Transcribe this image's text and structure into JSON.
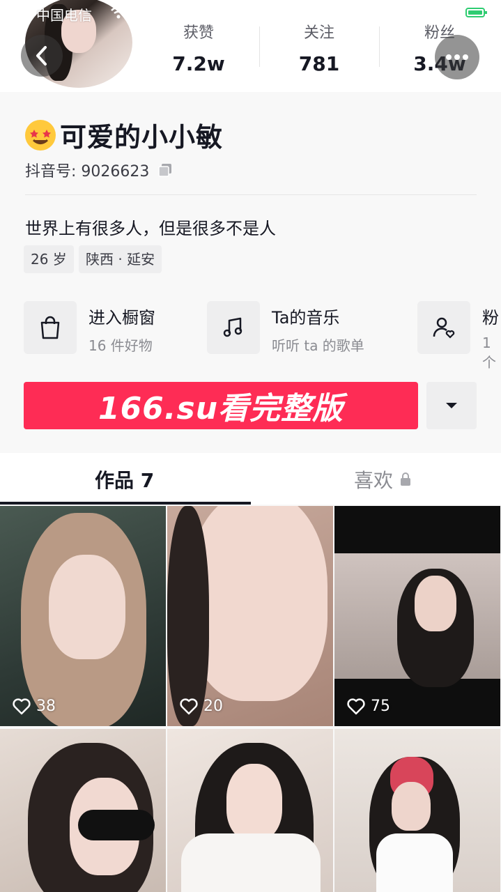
{
  "status_bar": {
    "carrier": "中国电信"
  },
  "stats": [
    {
      "label": "获赞",
      "value": "7.2w"
    },
    {
      "label": "关注",
      "value": "781"
    },
    {
      "label": "粉丝",
      "value": "3.4w"
    }
  ],
  "profile": {
    "name": "可爱的小小敏",
    "id_label": "抖音号: 9026623",
    "bio": "世界上有很多人，但是很多不是人",
    "tags": [
      "26 岁",
      "陕西 · 延安"
    ]
  },
  "features": [
    {
      "title": "进入橱窗",
      "subtitle": "16 件好物",
      "icon": "shopping-bag-icon"
    },
    {
      "title": "Ta的音乐",
      "subtitle": "听听 ta 的歌单",
      "icon": "music-note-icon"
    },
    {
      "title": "粉",
      "subtitle": "1个",
      "icon": "user-heart-icon"
    }
  ],
  "cta": {
    "label": "166.su看完整版"
  },
  "tabs": {
    "works": "作品 7",
    "likes": "喜欢"
  },
  "videos": [
    {
      "likes": "38",
      "bg": "#3a4a44"
    },
    {
      "likes": "20",
      "bg": "#b89a8e"
    },
    {
      "likes": "75",
      "bg": "#1a1a1a"
    },
    {
      "likes": "",
      "bg": "#d9cfc8"
    },
    {
      "likes": "",
      "bg": "#e8ded6"
    },
    {
      "likes": "",
      "bg": "#e9e4df"
    }
  ],
  "colors": {
    "accent": "#fe2c55",
    "text": "#161823",
    "muted": "#8a8b91"
  }
}
